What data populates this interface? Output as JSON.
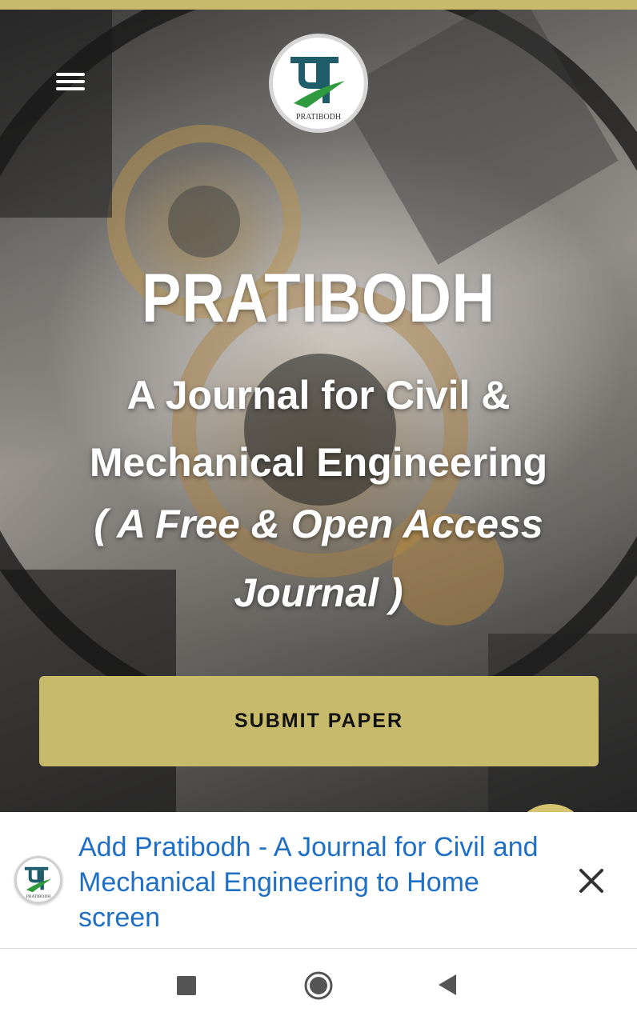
{
  "header": {
    "menu_icon": "hamburger-menu-icon",
    "logo_text": "PRATIBODH"
  },
  "hero": {
    "title": "PRATIBODH",
    "subtitle": "A Journal for Civil & Mechanical Engineering",
    "tagline": "( A Free & Open Access Journal )",
    "submit_label": "SUBMIT PAPER"
  },
  "install_banner": {
    "text": "Add Pratibodh - A Journal for Civil and Mechanical Engineering to Home screen",
    "icon_text": "PRATIBODH",
    "close_icon": "close-icon"
  },
  "nav": {
    "recents_icon": "square-recents-icon",
    "home_icon": "circle-home-icon",
    "back_icon": "triangle-back-icon"
  },
  "colors": {
    "accent": "#c8ba6b",
    "link": "#1f6fc6",
    "logo_teal": "#1f5d6a",
    "logo_green": "#2f9a3e"
  }
}
